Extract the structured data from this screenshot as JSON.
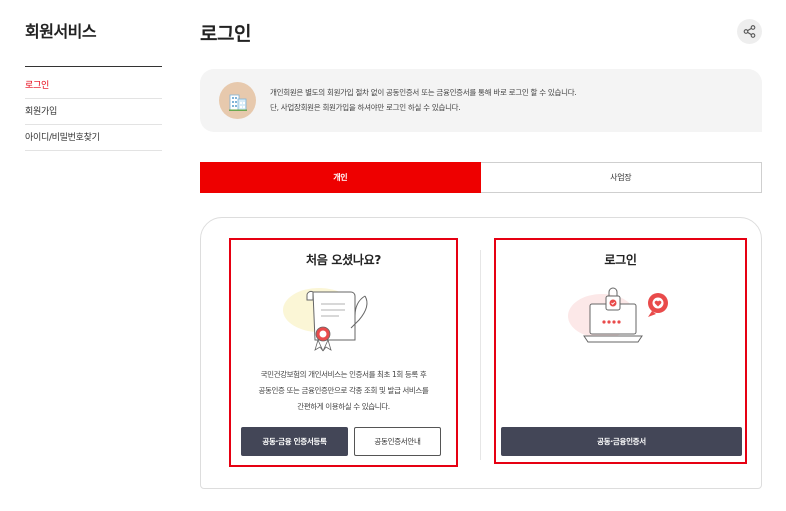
{
  "sidebar": {
    "title": "회원서비스",
    "items": [
      {
        "label": "로그인",
        "active": true
      },
      {
        "label": "회원가입",
        "active": false
      },
      {
        "label": "아이디/비밀번호찾기",
        "active": false
      }
    ]
  },
  "header": {
    "title": "로그인",
    "share_icon": "share-icon"
  },
  "notice": {
    "icon": "building-icon",
    "line1": "개인회원은 별도의 회원가입 절차 없이 공동인증서 또는 금융인증서를 통해 바로 로그인 할 수 있습니다.",
    "line2": "단, 사업장회원은 회원가입을 하셔야만 로그인 하실 수 있습니다."
  },
  "tabs": [
    {
      "label": "개인",
      "active": true
    },
    {
      "label": "사업장",
      "active": false
    }
  ],
  "first_visit": {
    "title": "처음 오셨나요?",
    "illustration": "certificate-scroll-icon",
    "desc_line1": "국민건강보험의 개인서비스는 인증서를 최초 1회 등록 후",
    "desc_line2": "공동인증 또는 금융인증만으로 각종 조회 및 발급 서비스를",
    "desc_line3": "간편하게 이용하실 수 있습니다.",
    "register_button": "공동·금융 인증서등록",
    "guide_button": "공동인증서안내"
  },
  "login": {
    "title": "로그인",
    "illustration": "laptop-lock-icon",
    "login_button": "공동·금융인증서"
  },
  "colors": {
    "accent": "#e60012",
    "tab_active": "#ee0000",
    "button_dark": "#434657"
  }
}
